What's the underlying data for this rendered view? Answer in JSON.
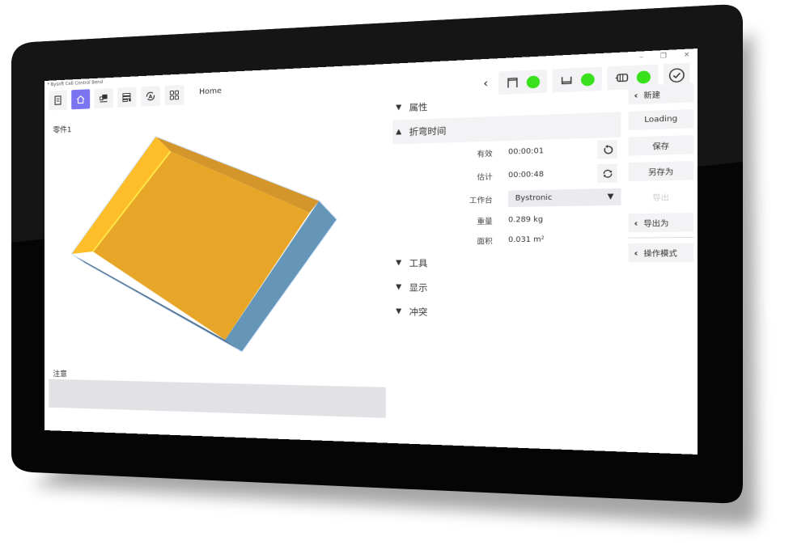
{
  "app": {
    "title": "* Bysoft Cell Control Bend",
    "window_controls": [
      "–",
      "❐",
      "✕"
    ]
  },
  "toolbar": {
    "buttons": [
      {
        "name": "document-icon",
        "active": false
      },
      {
        "name": "home-icon",
        "active": true
      },
      {
        "name": "machine-transfer-icon",
        "active": false
      },
      {
        "name": "list-settings-icon",
        "active": false
      },
      {
        "name": "auto-mode-icon",
        "active": false
      },
      {
        "name": "grid-icon",
        "active": false
      }
    ],
    "breadcrumb": "Home"
  },
  "status_bar": {
    "back": "‹",
    "indicators": [
      {
        "name": "upper-tool",
        "status_color": "#39e11d"
      },
      {
        "name": "lower-tool",
        "status_color": "#39e11d"
      },
      {
        "name": "backgauge",
        "status_color": "#39e11d"
      }
    ],
    "confirm": "✓"
  },
  "viewer": {
    "part_name": "零件1",
    "model_colors": {
      "inner": "#e8a628",
      "left_wall": "#fdbe2a",
      "back_wall": "#d4962a",
      "outer_side": "#6596b8",
      "outer_front": "#4f7290"
    }
  },
  "notes": {
    "label": "注意",
    "content": ""
  },
  "properties": {
    "sections": [
      {
        "label": "属性",
        "expanded": false
      },
      {
        "label": "折弯时间",
        "expanded": true
      },
      {
        "label": "工具",
        "expanded": false
      },
      {
        "label": "显示",
        "expanded": false
      },
      {
        "label": "冲突",
        "expanded": false
      }
    ],
    "bend_time": {
      "effective_label": "有效",
      "effective_value": "00:00:01",
      "estimated_label": "估计",
      "estimated_value": "00:00:48",
      "workbench_label": "工作台",
      "workbench_value": "Bystronic",
      "weight_label": "重量",
      "weight_value": "0.289 kg",
      "area_label": "面积",
      "area_value": "0.031 m²"
    }
  },
  "side_menu": {
    "new": "新建",
    "loading": "Loading",
    "save": "保存",
    "save_as": "另存为",
    "export": "导出",
    "export_as": "导出为",
    "operation_mode": "操作模式"
  }
}
